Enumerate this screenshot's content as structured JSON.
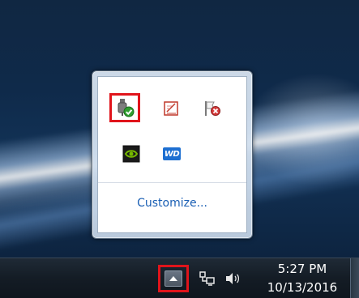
{
  "flyout": {
    "customize_label": "Customize...",
    "icons": [
      {
        "name": "safely-remove-hardware-icon",
        "selected": true
      },
      {
        "name": "notes-edit-icon",
        "selected": false
      },
      {
        "name": "action-center-flag-icon",
        "selected": false
      },
      {
        "name": "nvidia-icon",
        "selected": false
      },
      {
        "name": "wd-icon",
        "selected": false
      }
    ],
    "wd_text": "WD"
  },
  "taskbar": {
    "time": "5:27 PM",
    "date": "10/13/2016",
    "show_hidden_icons": {
      "selected": true
    },
    "system_icons": [
      "network-icon",
      "volume-icon"
    ]
  },
  "colors": {
    "highlight": "#e0141b",
    "link": "#1a5fb4",
    "nvidia_green": "#76b900",
    "wd_blue": "#1d6fd1"
  }
}
